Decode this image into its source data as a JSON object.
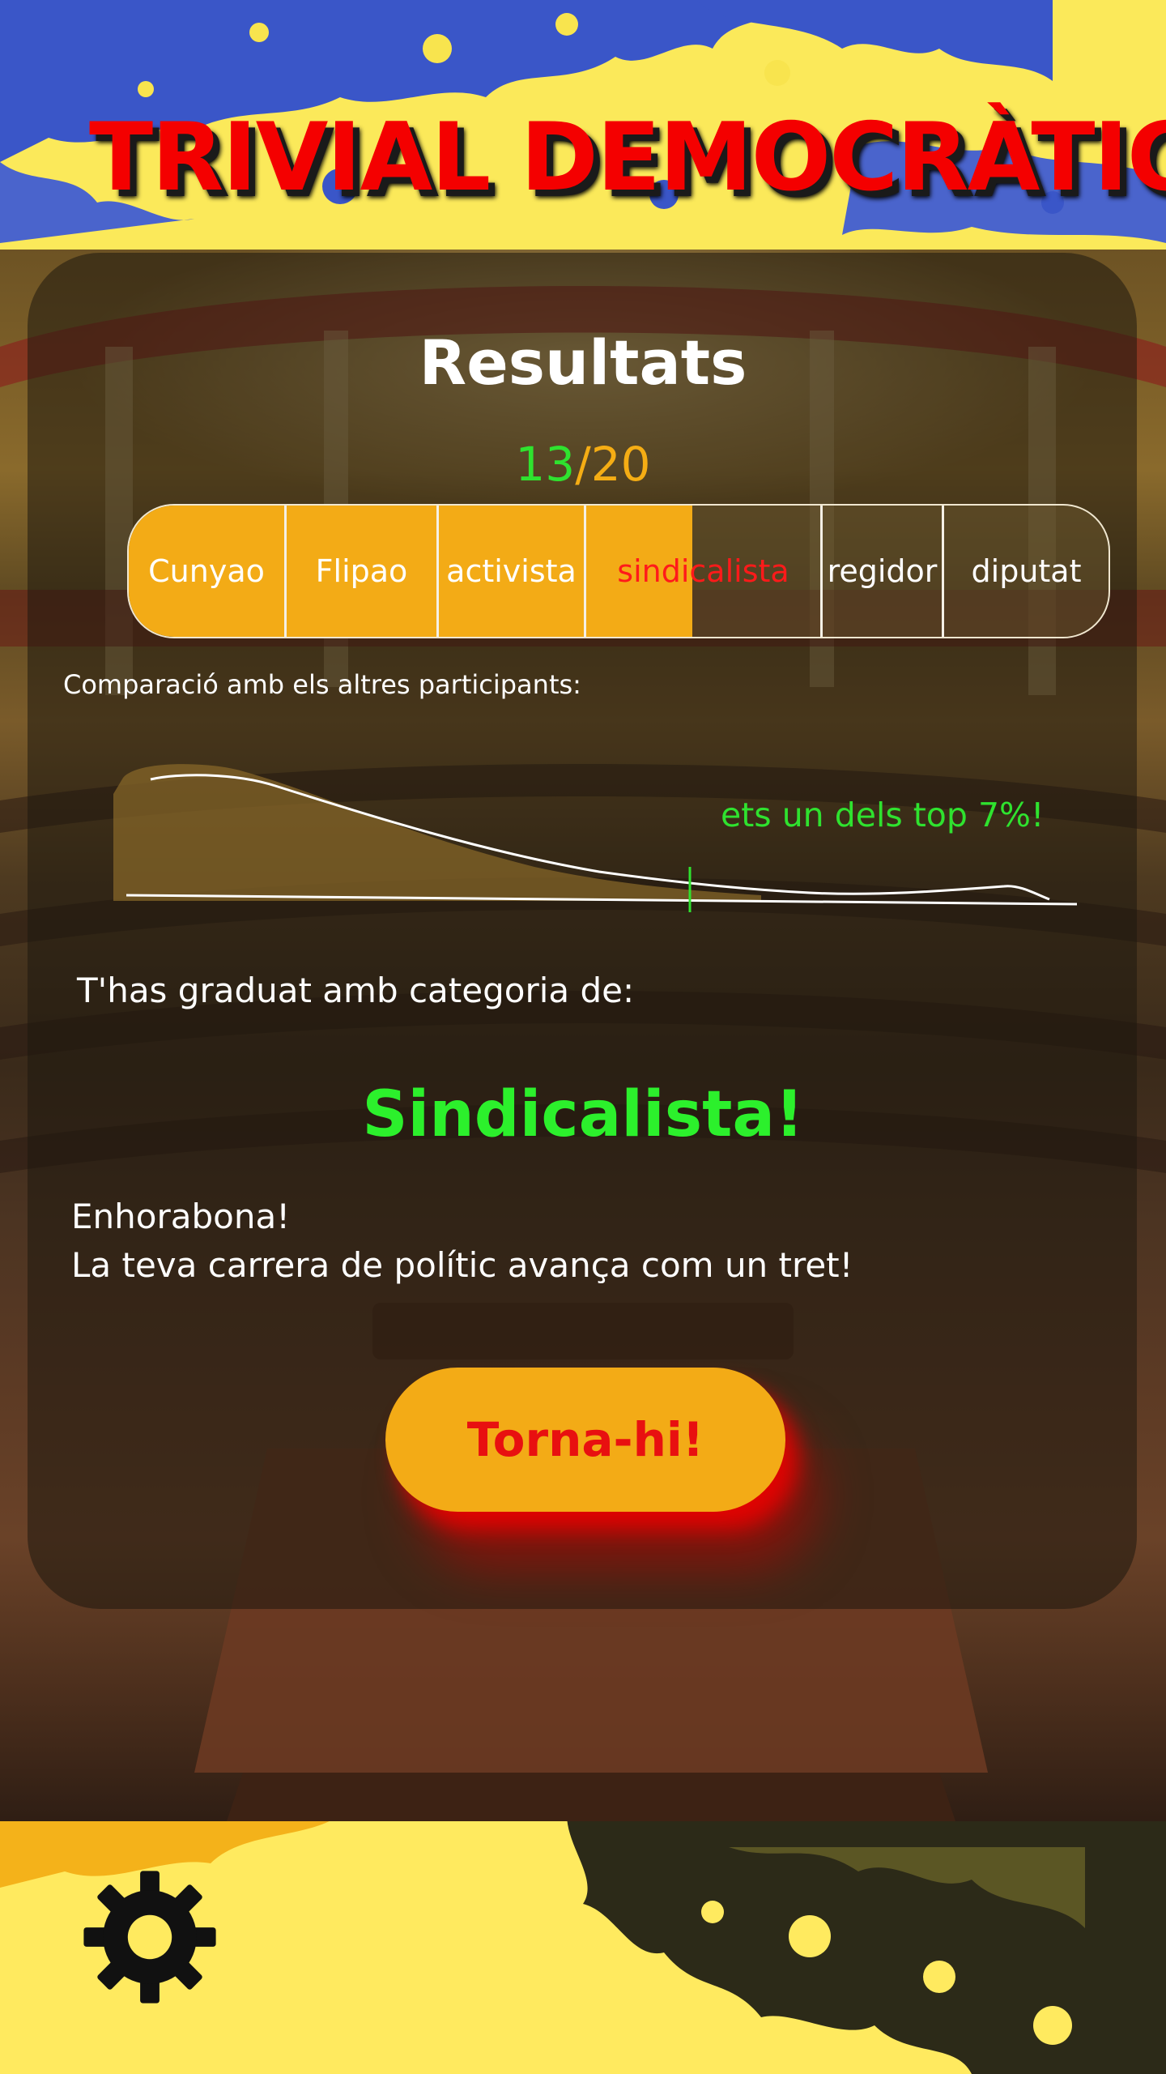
{
  "app": {
    "title": "TRIVIAL DEMOCRÀTIC"
  },
  "results": {
    "heading": "Resultats",
    "score": {
      "correct": "13",
      "separator": "/",
      "total": "20"
    },
    "ranks": [
      {
        "label": "Cunyao"
      },
      {
        "label": "Flipao"
      },
      {
        "label": "activista"
      },
      {
        "label": "sindicalista"
      },
      {
        "label": "regidor"
      },
      {
        "label": "diputat"
      }
    ],
    "current_rank_index": 3,
    "progress_fraction": 0.575,
    "comparison_label": "Comparació amb els altres participants:",
    "top_percent_text": "ets un dels top 7%!",
    "graduated_label": "T'has graduat amb categoria de:",
    "category": "Sindicalista!",
    "congrats_line1": "Enhorabona!",
    "congrats_line2": "La teva carrera de polític avança com un tret!",
    "retry_label": "Torna-hi!"
  },
  "colors": {
    "accent": "#f3ab16",
    "title_red": "#f40000",
    "highlight_green": "#2fe22f",
    "button_text": "#e81010"
  },
  "icons": {
    "settings": "gear-icon"
  }
}
